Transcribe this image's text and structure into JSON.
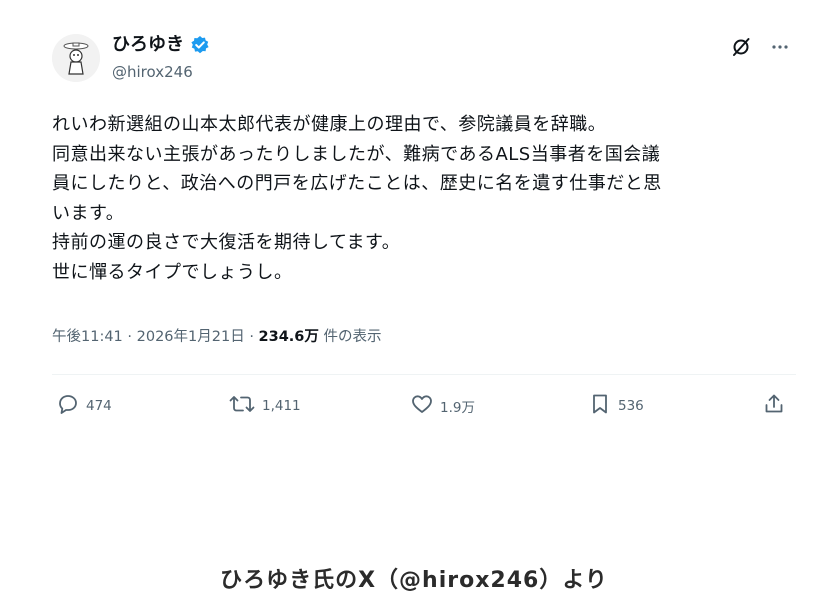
{
  "author": {
    "name": "ひろゆき",
    "handle": "@hirox246"
  },
  "tweet": {
    "lines": [
      "れいわ新選組の山本太郎代表が健康上の理由で、参院議員を辞職。",
      "同意出来ない主張があったりしましたが、難病であるALS当事者を国会議",
      "員にしたりと、政治への門戸を広げたことは、歴史に名を遺す仕事だと思",
      "います。",
      "持前の運の良さで大復活を期待してます。",
      "世に憚るタイプでしょうし。"
    ],
    "time": "午後11:41",
    "sep": "·",
    "date": "2026年1月21日",
    "views_count": "234.6万",
    "views_label": "件の表示"
  },
  "actions": {
    "replies": "474",
    "reposts": "1,411",
    "likes": "1.9万",
    "bookmarks": "536"
  },
  "caption": "ひろゆき氏のX（@hirox246）より",
  "colors": {
    "verified": "#1d9bf0",
    "secondary_text": "#536471",
    "primary_text": "#0f1419"
  },
  "icons": [
    "grok-icon",
    "more-icon",
    "reply-icon",
    "repost-icon",
    "like-icon",
    "bookmark-icon",
    "share-icon",
    "verified-badge-icon"
  ]
}
